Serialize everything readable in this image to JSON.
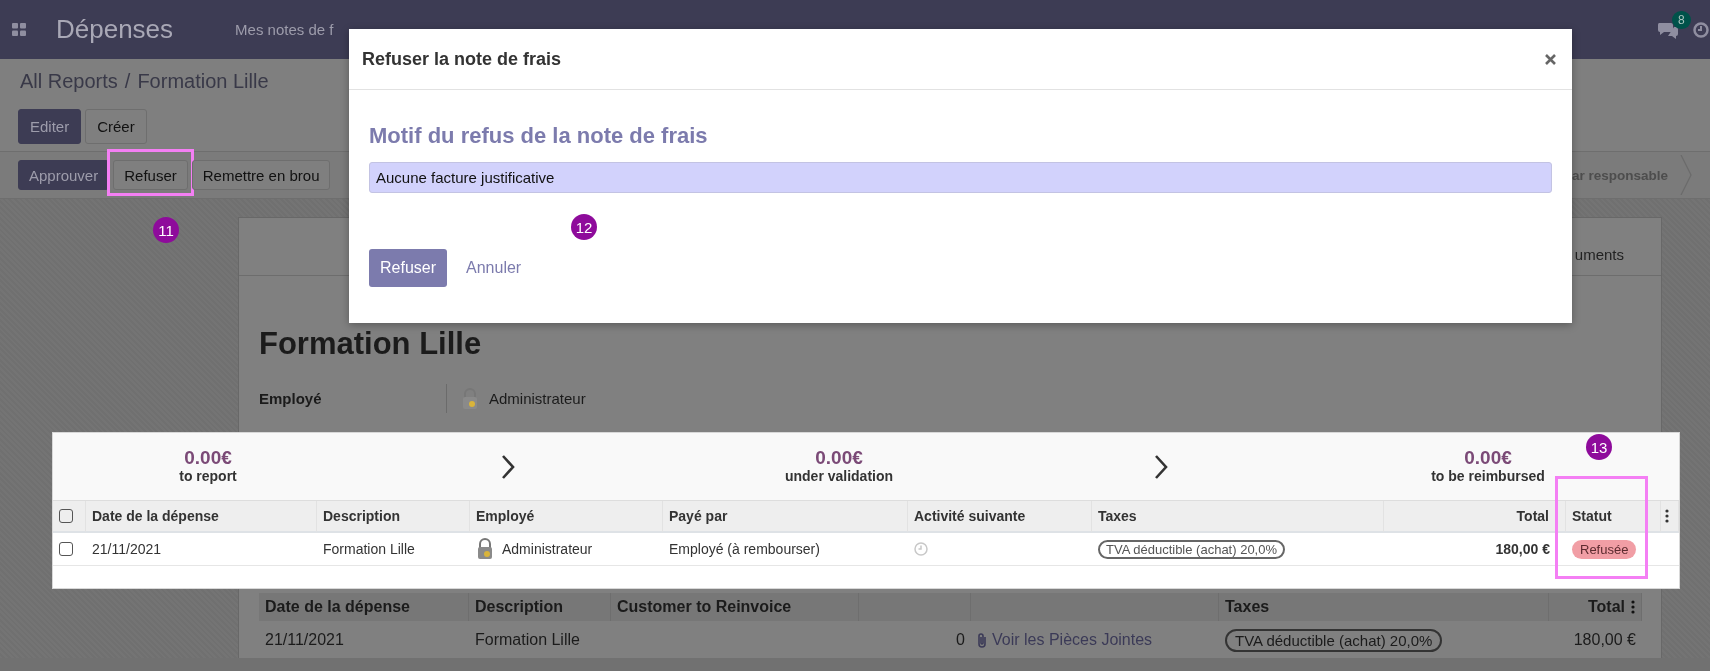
{
  "navbar": {
    "app_title": "Dépenses",
    "menu": [
      "Mes notes de f"
    ],
    "chat_badge": "8"
  },
  "breadcrumb": {
    "parent": "All Reports",
    "separator": "/",
    "current": "Formation Lille"
  },
  "form_buttons": [
    {
      "label": "Editer",
      "kind": "primary"
    },
    {
      "label": "Créer",
      "kind": "secondary"
    }
  ],
  "status_buttons": [
    {
      "label": "Approuver",
      "kind": "primary",
      "highlighted": false
    },
    {
      "label": "Refuser",
      "kind": "secondary",
      "highlighted": true
    },
    {
      "label": "Remettre en brou",
      "kind": "secondary",
      "highlighted": false
    }
  ],
  "status_stage": "ar responsable",
  "sheet": {
    "tab": "uments",
    "title": "Formation Lille",
    "fields": [
      {
        "label": "Employé",
        "value": "Administrateur"
      }
    ],
    "lines": {
      "columns": [
        "Date de la dépense",
        "Description",
        "Customer to Reinvoice",
        "Taxes",
        "Total"
      ],
      "rows": [
        {
          "date": "21/11/2021",
          "description": "Formation Lille",
          "quantity": "0",
          "attachments": "Voir les Pièces Jointes",
          "taxes": "TVA déductible (achat) 20,0%",
          "total": "180,00 €"
        }
      ]
    }
  },
  "dialog": {
    "title": "Refuser la note de frais",
    "heading": "Motif du refus de la note de frais",
    "reason": "Aucune facture justificative",
    "buttons": [
      {
        "label": "Refuser",
        "kind": "primary"
      },
      {
        "label": "Annuler",
        "kind": "link"
      }
    ]
  },
  "report_panel": {
    "summary": [
      {
        "amount": "0.00€",
        "label": "to report"
      },
      {
        "amount": "0.00€",
        "label": "under validation"
      },
      {
        "amount": "0.00€",
        "label": "to be reimbursed"
      }
    ],
    "columns": [
      "Date de la dépense",
      "Description",
      "Employé",
      "Payé par",
      "Activité suivante",
      "Taxes",
      "Total",
      "Statut"
    ],
    "header_checked": false,
    "status_highlighted": true,
    "rows": [
      {
        "checked": false,
        "date": "21/11/2021",
        "description": "Formation Lille",
        "employee": "Administrateur",
        "paid_by": "Employé (à rembourser)",
        "taxes": "TVA déductible (achat) 20,0%",
        "total": "180,00 €",
        "status": "Refusée"
      }
    ]
  },
  "step_markers": [
    "11",
    "12",
    "13"
  ]
}
